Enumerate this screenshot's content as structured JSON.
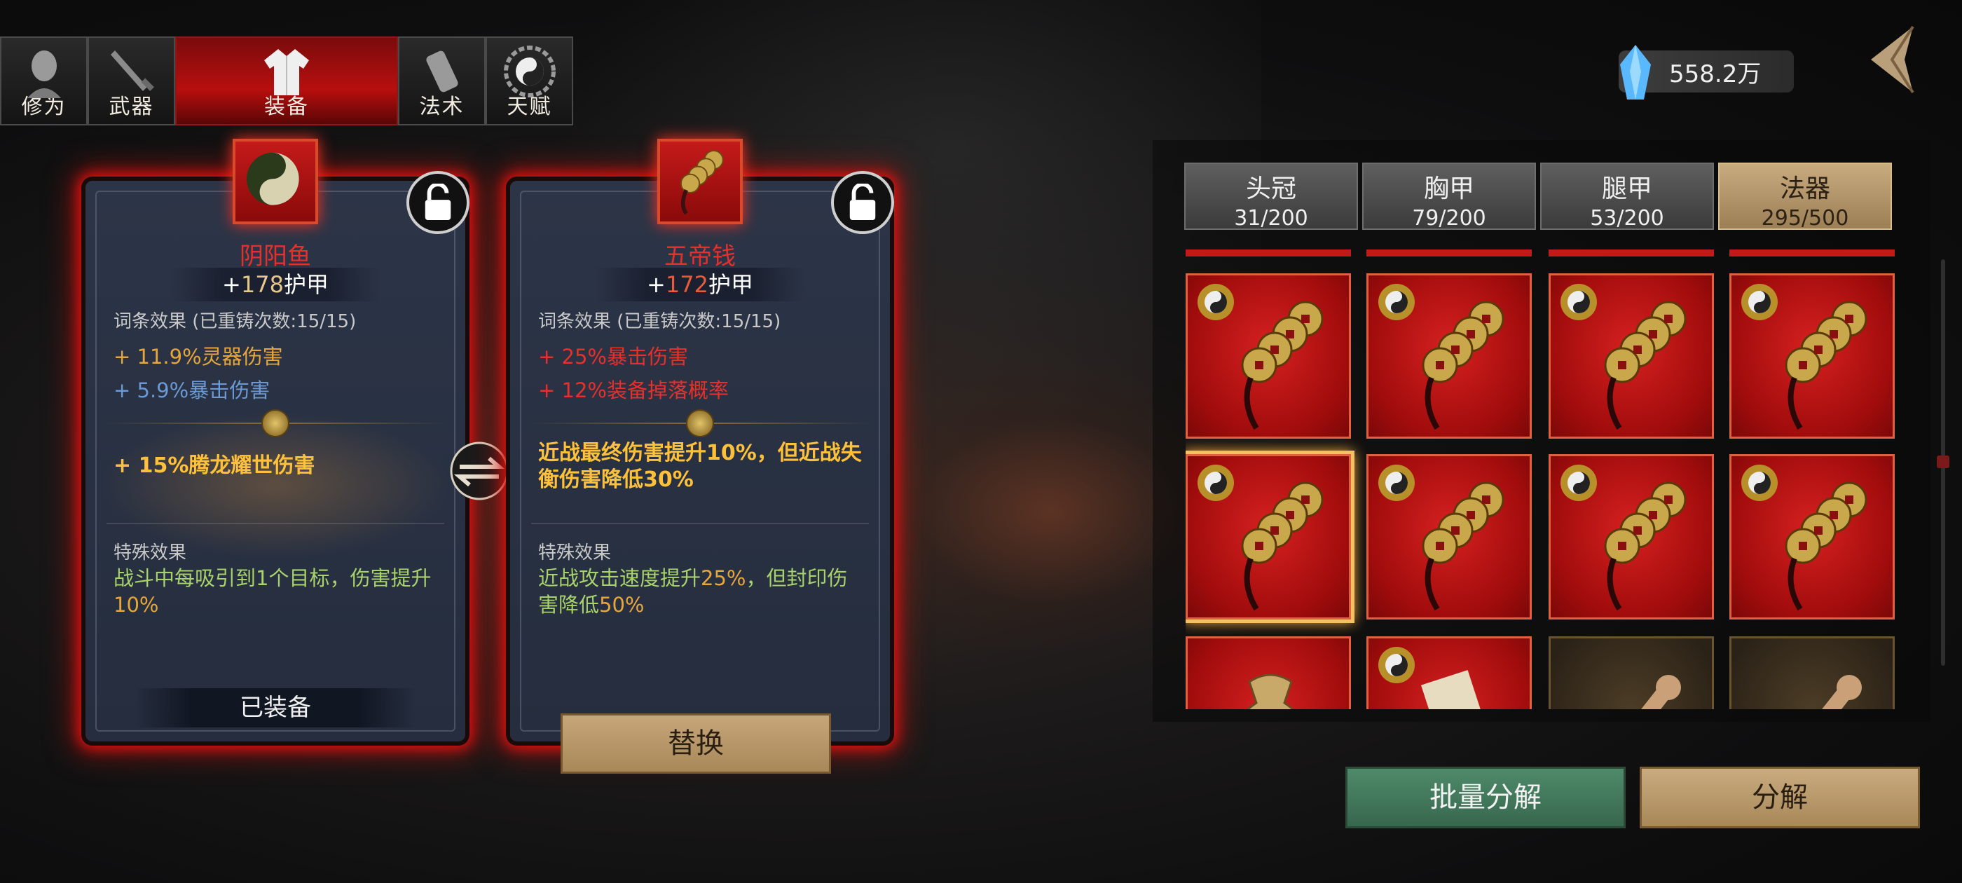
{
  "tabs": [
    {
      "label": "修为",
      "icon": "monk-head-icon"
    },
    {
      "label": "武器",
      "icon": "sword-icon"
    },
    {
      "label": "装备",
      "icon": "robe-icon",
      "active": true
    },
    {
      "label": "法术",
      "icon": "scroll-icon"
    },
    {
      "label": "天赋",
      "icon": "bagua-icon"
    }
  ],
  "currency": {
    "amount": "558.2万",
    "icon": "crystal-icon"
  },
  "equipped_card": {
    "name": "阴阳鱼",
    "armor_prefix": "+",
    "armor_value": "178",
    "armor_label": "护甲",
    "affix_title": "词条效果  (已重铸次数:15/15)",
    "stats": [
      {
        "text": "+ 11.9%灵器伤害",
        "color": "#e7a63a"
      },
      {
        "text": "+ 5.9%",
        "color": "#6a9ad6"
      },
      {
        "text": "暴击伤害",
        "color": "#6a9ad6"
      }
    ],
    "special_bonus": "+ 15%腾龙耀世伤害",
    "special_title": "特殊效果",
    "special_text_a": "战斗中每吸引到1个目标，伤害提升",
    "special_text_hl": "10%",
    "status": "已装备"
  },
  "compare_card": {
    "name": "五帝钱",
    "armor_prefix": "+",
    "armor_value": "172",
    "armor_label": "护甲",
    "affix_title": "词条效果  (已重铸次数:15/15)",
    "stats": [
      {
        "text": "+ 25%暴击伤害",
        "color": "#e8302a"
      },
      {
        "text": "+ 12%装备掉落概率",
        "color": "#e8302a"
      }
    ],
    "special_bonus": "近战最终伤害提升10%，但近战失衡伤害降低30%",
    "special_title": "特殊效果",
    "special_text_a": "近战攻击速度提升",
    "special_text_hl1": "25%",
    "special_text_b": "，但封印伤害降低",
    "special_text_hl2": "50%",
    "replace_label": "替换"
  },
  "categories": [
    {
      "name": "头冠",
      "count": "31/200"
    },
    {
      "name": "胸甲",
      "count": "79/200"
    },
    {
      "name": "腿甲",
      "count": "53/200"
    },
    {
      "name": "法器",
      "count": "295/500",
      "active": true
    }
  ],
  "inventory_rows": [
    [
      "coins",
      "coins",
      "coins",
      "coins"
    ],
    [
      "coins-selected",
      "coins",
      "coins",
      "coins"
    ],
    [
      "pouch",
      "talisman",
      "whisk",
      "whisk"
    ]
  ],
  "buttons": {
    "bulk_decompose": "批量分解",
    "decompose": "分解"
  },
  "colors": {
    "accent_red": "#c01a1a",
    "gold": "#e7a63a",
    "green_text": "#a8d26a",
    "panel_bg": "#2c3547"
  }
}
